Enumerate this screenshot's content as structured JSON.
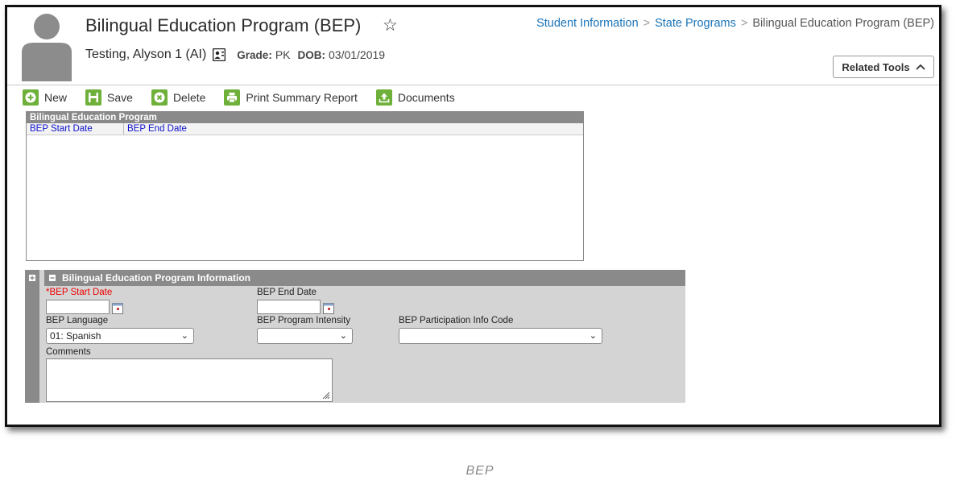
{
  "header": {
    "title": "Bilingual Education Program (BEP)",
    "breadcrumbs": [
      "Student Information",
      "State Programs",
      "Bilingual Education Program (BEP)"
    ],
    "student_name": "Testing, Alyson 1 (AI)",
    "grade_label": "Grade:",
    "grade_value": "PK",
    "dob_label": "DOB:",
    "dob_value": "03/01/2019",
    "related_tools": "Related Tools"
  },
  "toolbar": {
    "new": "New",
    "save": "Save",
    "delete": "Delete",
    "print": "Print Summary Report",
    "documents": "Documents"
  },
  "list": {
    "title": "Bilingual Education Program",
    "columns": [
      "BEP Start Date",
      "BEP End Date"
    ]
  },
  "detail": {
    "title": "Bilingual Education Program Information",
    "start_date_label": "*BEP Start Date",
    "start_date_value": "",
    "end_date_label": "BEP End Date",
    "end_date_value": "",
    "language_label": "BEP Language",
    "language_value": "01: Spanish",
    "intensity_label": "BEP Program Intensity",
    "intensity_value": "",
    "participation_label": "BEP Participation Info Code",
    "participation_value": "",
    "comments_label": "Comments",
    "comments_value": ""
  },
  "caption": "BEP",
  "colors": {
    "accent": "#6fb03b",
    "link": "#1a73b8",
    "required": "#e00000",
    "panel": "#8a8a8a"
  }
}
